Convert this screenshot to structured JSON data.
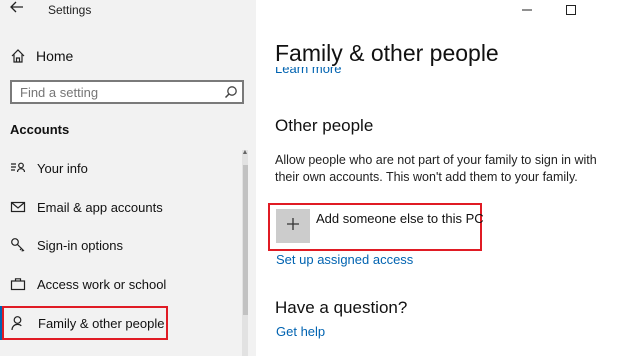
{
  "window": {
    "title": "Settings",
    "back_icon": "back-arrow-icon",
    "minimize_icon": "minimize-icon",
    "maximize_icon": "maximize-icon"
  },
  "sidebar": {
    "home_label": "Home",
    "search_placeholder": "Find a setting",
    "section_title": "Accounts",
    "items": [
      {
        "label": "Your info",
        "icon": "contact-card-icon"
      },
      {
        "label": "Email & app accounts",
        "icon": "mail-icon"
      },
      {
        "label": "Sign-in options",
        "icon": "key-icon"
      },
      {
        "label": "Access work or school",
        "icon": "briefcase-icon"
      },
      {
        "label": "Family & other people",
        "icon": "person-icon",
        "active": true
      }
    ]
  },
  "main": {
    "page_title": "Family & other people",
    "learn_more": "Learn more",
    "other_people": {
      "heading": "Other people",
      "description": "Allow people who are not part of your family to sign in with their own accounts. This won't add them to your family.",
      "add_label": "Add someone else to this PC",
      "assigned_access_link": "Set up assigned access"
    },
    "question": {
      "heading": "Have a question?",
      "help_link": "Get help"
    }
  },
  "colors": {
    "accent": "#0063b1",
    "highlight": "#e01b24",
    "sidebar_bg": "#f2f2f2"
  }
}
